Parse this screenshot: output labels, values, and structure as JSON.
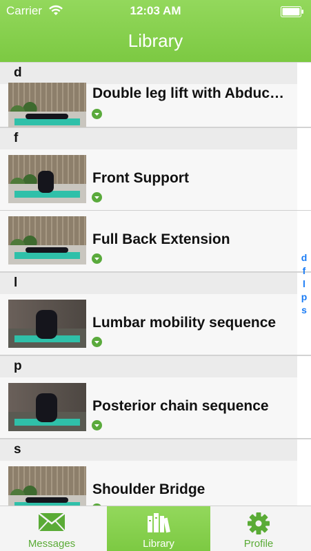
{
  "status_bar": {
    "carrier": "Carrier",
    "time": "12:03 AM"
  },
  "header": {
    "title": "Library"
  },
  "sections": [
    {
      "letter": "d",
      "items": [
        {
          "title": "Double leg lift with Abduction"
        }
      ]
    },
    {
      "letter": "f",
      "items": [
        {
          "title": "Front Support"
        },
        {
          "title": "Full Back Extension"
        }
      ]
    },
    {
      "letter": "l",
      "items": [
        {
          "title": "Lumbar mobility sequence"
        }
      ]
    },
    {
      "letter": "p",
      "items": [
        {
          "title": "Posterior chain sequence"
        }
      ]
    },
    {
      "letter": "s",
      "items": [
        {
          "title": "Shoulder Bridge"
        }
      ]
    }
  ],
  "index": [
    "d",
    "f",
    "l",
    "p",
    "s"
  ],
  "tabs": [
    {
      "label": "Messages",
      "icon": "envelope-icon"
    },
    {
      "label": "Library",
      "icon": "books-icon"
    },
    {
      "label": "Profile",
      "icon": "gear-icon"
    }
  ],
  "colors": {
    "accent": "#7cc942",
    "index_link": "#1a7cf5",
    "download": "#5aaa3c"
  }
}
